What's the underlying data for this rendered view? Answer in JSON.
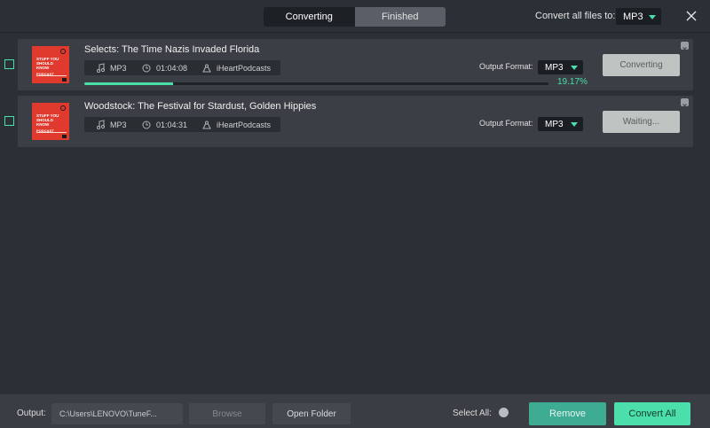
{
  "tabs": {
    "converting": "Converting",
    "finished": "Finished"
  },
  "header": {
    "convert_all_label": "Convert all files to:",
    "convert_all_format": "MP3"
  },
  "cover": {
    "brand": "STUFF YOU SHOULD KNOW",
    "sub": "PODCAST"
  },
  "items": [
    {
      "title": "Selects: The Time Nazis Invaded Florida",
      "format": "MP3",
      "duration": "01:04:08",
      "publisher": "iHeartPodcasts",
      "output_format_label": "Output Format:",
      "output_format": "MP3",
      "action_label": "Converting",
      "progress_percent": 19.17,
      "progress_text": "19.17%"
    },
    {
      "title": "Woodstock: The Festival for Stardust, Golden Hippies",
      "format": "MP3",
      "duration": "01:04:31",
      "publisher": "iHeartPodcasts",
      "output_format_label": "Output Format:",
      "output_format": "MP3",
      "action_label": "Waiting..."
    }
  ],
  "footer": {
    "output_label": "Output:",
    "output_path": "C:\\Users\\LENOVO\\TuneF...",
    "browse": "Browse",
    "open_folder": "Open Folder",
    "select_all": "Select All:",
    "remove": "Remove",
    "convert_all": "Convert All"
  },
  "colors": {
    "accent": "#46e0a8",
    "background": "#2b2f36",
    "card": "#3b3e44"
  }
}
